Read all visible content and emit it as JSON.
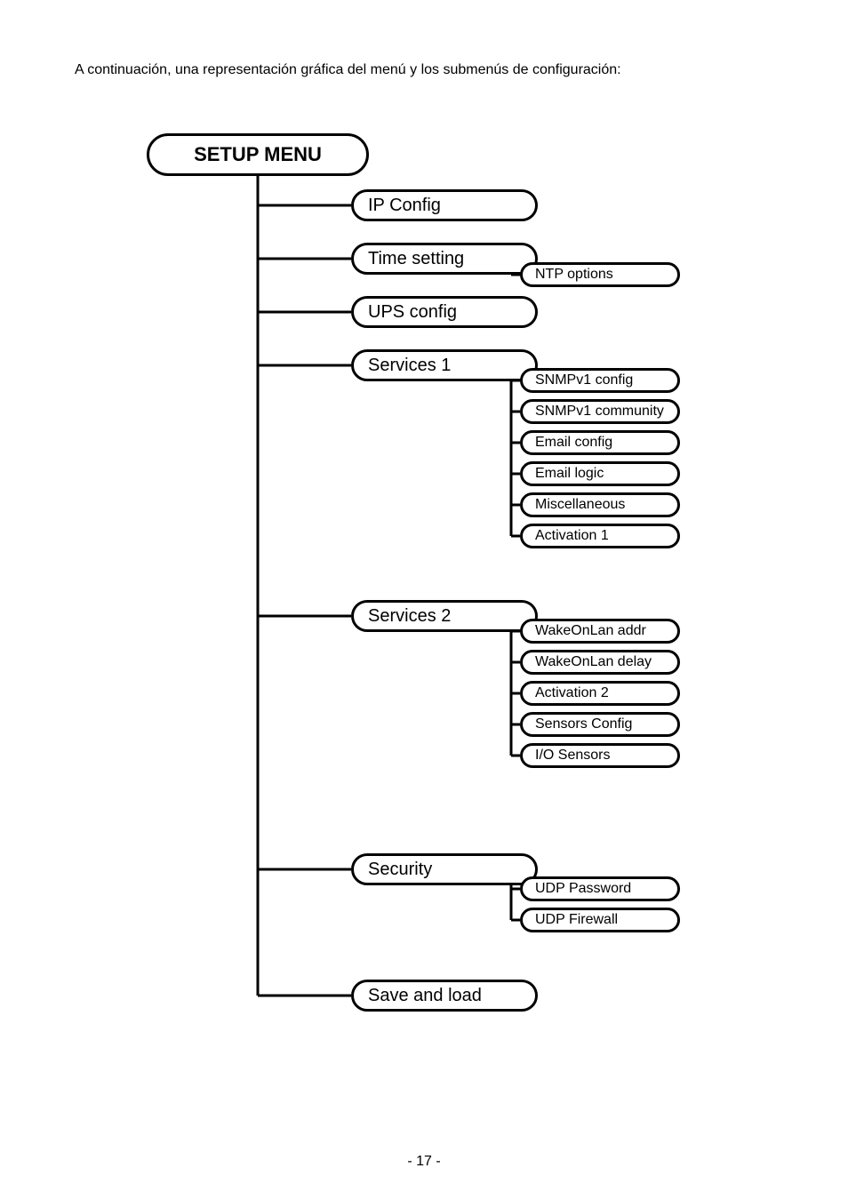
{
  "intro_text": "A continuación, una representación gráfica del menú y los submenús de configuración:",
  "page_number": "- 17 -",
  "tree": {
    "root": {
      "label": "SETUP MENU"
    },
    "level1": {
      "ip_config": {
        "label": "IP Config"
      },
      "time_setting": {
        "label": "Time setting"
      },
      "ups_config": {
        "label": "UPS config"
      },
      "services_1": {
        "label": "Services 1"
      },
      "services_2": {
        "label": "Services 2"
      },
      "security": {
        "label": "Security"
      },
      "save_load": {
        "label": "Save and load"
      }
    },
    "time_setting_children": {
      "ntp_options": {
        "label": "NTP options"
      }
    },
    "services_1_children": {
      "snmpv1_config": {
        "label": "SNMPv1 config"
      },
      "snmpv1_community": {
        "label": "SNMPv1 community"
      },
      "email_config": {
        "label": "Email config"
      },
      "email_logic": {
        "label": "Email logic"
      },
      "miscellaneous": {
        "label": "Miscellaneous"
      },
      "activation_1": {
        "label": "Activation 1"
      }
    },
    "services_2_children": {
      "wakeonlan_addr": {
        "label": "WakeOnLan addr"
      },
      "wakeonlan_delay": {
        "label": "WakeOnLan delay"
      },
      "activation_2": {
        "label": "Activation 2"
      },
      "sensors_config": {
        "label": "Sensors Config"
      },
      "io_sensors": {
        "label": "I/O Sensors"
      }
    },
    "security_children": {
      "udp_password": {
        "label": "UDP Password"
      },
      "udp_firewall": {
        "label": "UDP Firewall"
      }
    }
  }
}
